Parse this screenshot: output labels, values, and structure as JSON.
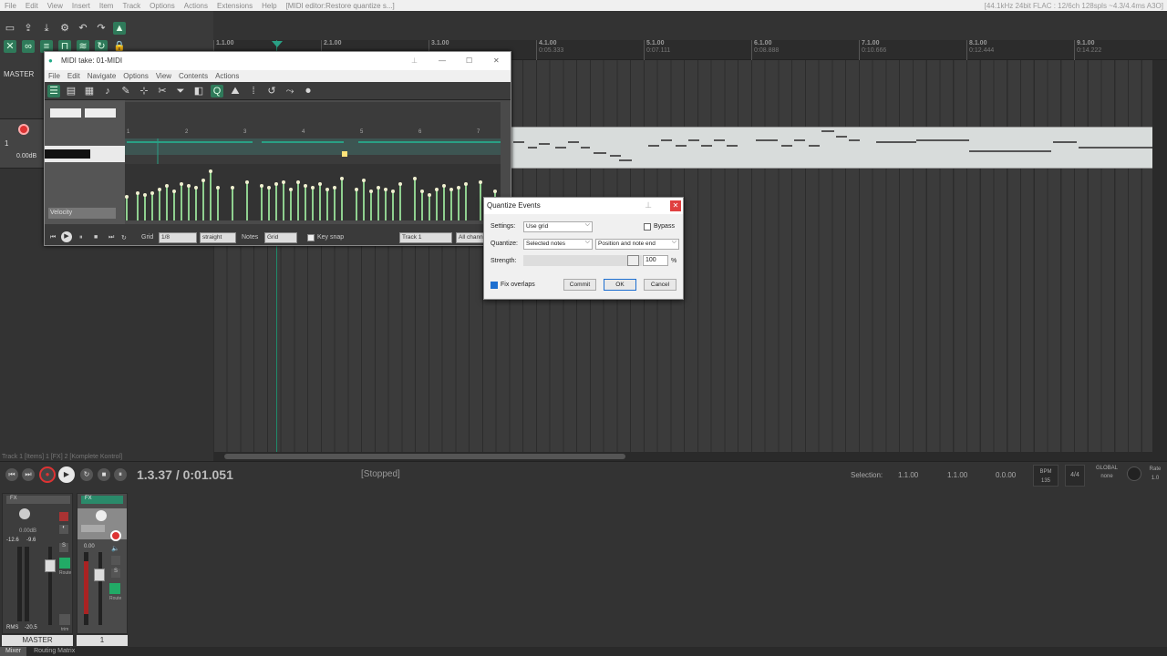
{
  "menubar": {
    "items": [
      "File",
      "Edit",
      "View",
      "Insert",
      "Item",
      "Track",
      "Options",
      "Actions",
      "Extensions",
      "Help"
    ],
    "title": "[MIDI editor:Restore quantize s...]",
    "status": "[44.1kHz 24bit FLAC : 12/6ch 128spls ~4.3/4.4ms A3O]"
  },
  "left": {
    "master_label": "MASTER",
    "track_number": "1",
    "track_volume": "0.00dB"
  },
  "ruler": {
    "marks": [
      {
        "bar": "1.1.00",
        "time": ""
      },
      {
        "bar": "2.1.00",
        "time": ""
      },
      {
        "bar": "3.1.00",
        "time": ""
      },
      {
        "bar": "4.1.00",
        "time": "0:05.333"
      },
      {
        "bar": "5.1.00",
        "time": "0:07.111"
      },
      {
        "bar": "6.1.00",
        "time": "0:08.888"
      },
      {
        "bar": "7.1.00",
        "time": "0:10.666"
      },
      {
        "bar": "8.1.00",
        "time": "0:12.444"
      },
      {
        "bar": "9.1.00",
        "time": "0:14.222"
      }
    ]
  },
  "midi_editor": {
    "title": "MIDI take: 01-MIDI",
    "menu": [
      "File",
      "Edit",
      "Navigate",
      "Options",
      "View",
      "Contents",
      "Actions"
    ],
    "velocity_label": "Velocity",
    "timeline_numbers": [
      "1",
      "2",
      "3",
      "4",
      "5",
      "6",
      "7"
    ],
    "grid_label": "Grid",
    "grid_value": "1/8",
    "grid_type": "straight",
    "notes_label": "Notes",
    "notes_value": "Grid",
    "key_snap": "Key snap",
    "track_value": "Track 1",
    "channel_value": "All chann"
  },
  "quantize_dialog": {
    "title": "Quantize Events",
    "settings_label": "Settings:",
    "settings_value": "Use grid",
    "bypass_label": "Bypass",
    "quantize_label": "Quantize:",
    "quantize_value": "Selected notes",
    "quantize_mode": "Position and note end",
    "strength_label": "Strength:",
    "strength_value": "100",
    "percent": "%",
    "fix_overlaps": "Fix overlaps",
    "commit": "Commit",
    "ok": "OK",
    "cancel": "Cancel"
  },
  "transport": {
    "track_info": "Track 1 [Items] 1 [FX] 2 [Komplete Kontrol]",
    "position": "1.3.37 / 0:01.051",
    "state": "[Stopped]",
    "selection_label": "Selection:",
    "sel_start": "1.1.00",
    "sel_end": "1.1.00",
    "sel_len": "0.0.00",
    "bpm_label": "BPM",
    "bpm": "135",
    "time_sig": "4/4",
    "global_label": "GLOBAL",
    "global_value": "none",
    "rate_label": "Rate",
    "rate": "1.0"
  },
  "mixer": {
    "master_fx": "FX",
    "track_fx": "FX",
    "master_vol": "0.00dB",
    "peak_l": "-12.6",
    "peak_r": "-9.6",
    "track_vol": "0.00",
    "rms_label": "RMS",
    "rms_value": "-20.5",
    "route": "Route",
    "trim": "trim",
    "master_name": "MASTER",
    "track_name": "1"
  },
  "bottom_tabs": [
    "Mixer",
    "Routing Matrix"
  ],
  "colors": {
    "accent": "#2aa085",
    "record": "#dd3333",
    "close": "#e04040",
    "checkbox": "#1e6fd0"
  }
}
